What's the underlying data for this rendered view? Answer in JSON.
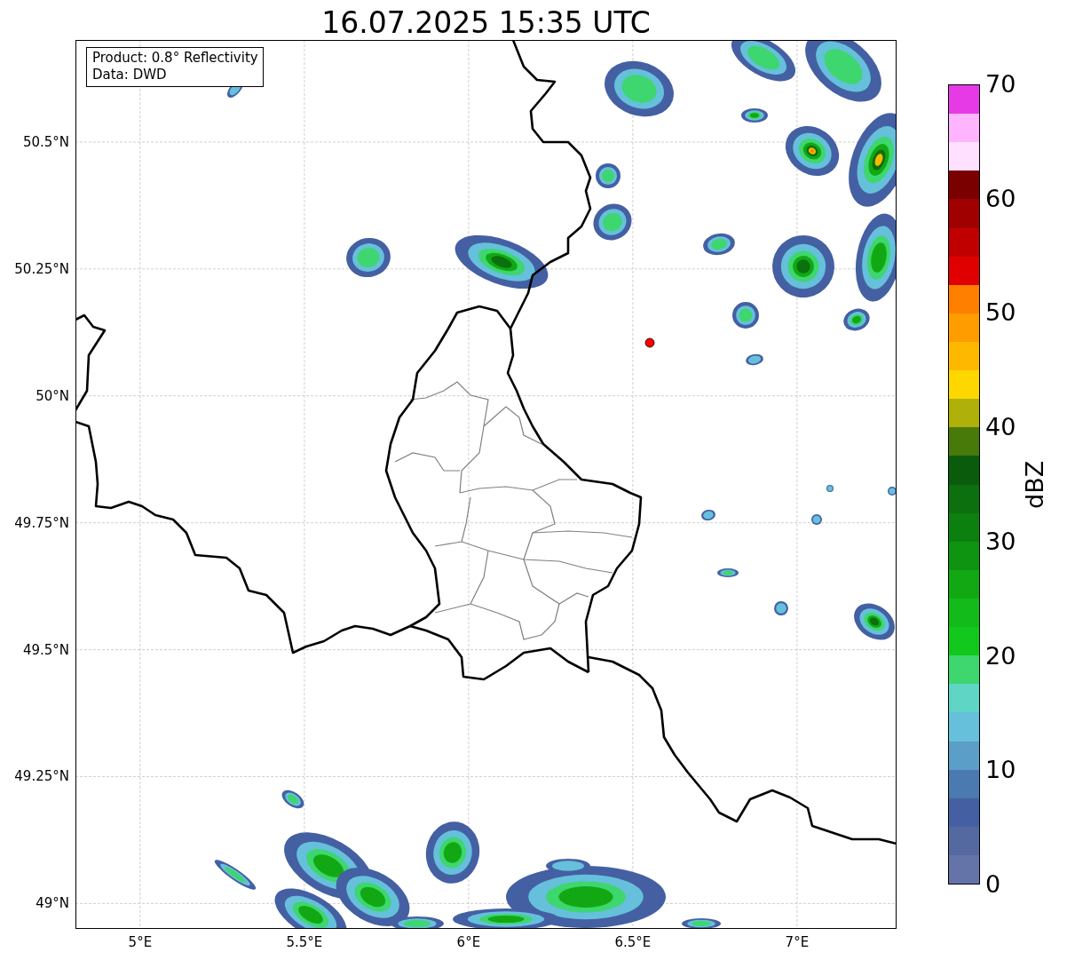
{
  "title": "16.07.2025 15:35 UTC",
  "info_box": [
    "Product: 0.8° Reflectivity",
    "Data: DWD"
  ],
  "map": {
    "lat_ticks": [
      "50.5°N",
      "50.25°N",
      "50°N",
      "49.75°N",
      "49.5°N",
      "49.25°N",
      "49°N"
    ],
    "lon_ticks": [
      "5°E",
      "5.5°E",
      "6°E",
      "6.5°E",
      "7°E"
    ]
  },
  "colorbar": {
    "label": "dBZ",
    "ticks": [
      "70",
      "60",
      "50",
      "40",
      "30",
      "20",
      "10",
      "0"
    ],
    "bins": [
      {
        "color": "#e63ae6"
      },
      {
        "color": "#ffb4ff"
      },
      {
        "color": "#ffe0ff"
      },
      {
        "color": "#7a0000"
      },
      {
        "color": "#a00000"
      },
      {
        "color": "#c00000"
      },
      {
        "color": "#e00000"
      },
      {
        "color": "#ff7f00"
      },
      {
        "color": "#ff9c00"
      },
      {
        "color": "#ffb800"
      },
      {
        "color": "#ffd700"
      },
      {
        "color": "#b0b00a"
      },
      {
        "color": "#487a0a"
      },
      {
        "color": "#0a5c0c"
      },
      {
        "color": "#0b700d"
      },
      {
        "color": "#0c800f"
      },
      {
        "color": "#0e9411"
      },
      {
        "color": "#12a814"
      },
      {
        "color": "#12bb1a"
      },
      {
        "color": "#13c81c"
      },
      {
        "color": "#3ed66e"
      },
      {
        "color": "#5fd6c5"
      },
      {
        "color": "#66c0dc"
      },
      {
        "color": "#5b9ec8"
      },
      {
        "color": "#4b7ab0"
      },
      {
        "color": "#4460a3"
      },
      {
        "color": "#54699f"
      },
      {
        "color": "#6474a8"
      }
    ]
  }
}
